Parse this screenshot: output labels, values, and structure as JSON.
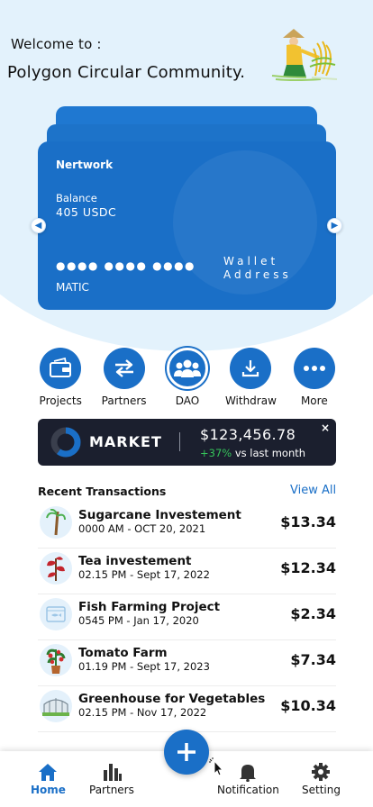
{
  "header": {
    "welcome": "Welcome  to :",
    "community": "Polygon Circular Community."
  },
  "card": {
    "network": "Nertwork",
    "balance_label": "Balance",
    "balance_value": "405 USDC",
    "masked_number": "●●●● ●●●● ●●●●",
    "wallet_line1": "Wallet",
    "wallet_line2": "Address",
    "currency": "MATIC"
  },
  "actions": [
    {
      "label": "Projects",
      "icon": "wallet-icon"
    },
    {
      "label": "Partners",
      "icon": "swap-arrows-icon"
    },
    {
      "label": "DAO",
      "icon": "group-icon"
    },
    {
      "label": "Withdraw",
      "icon": "download-icon"
    },
    {
      "label": "More",
      "icon": "more-dots-icon"
    }
  ],
  "market": {
    "title": "MARKET",
    "value": "$123,456.78",
    "change_pct": "+37%",
    "change_text": " vs last month",
    "ring_fraction": 0.6,
    "close": "×"
  },
  "recent": {
    "title": "Recent Transactions",
    "view_all": "View All",
    "items": [
      {
        "name": "Sugarcane Investement",
        "date": "0000 AM - OCT 20, 2021",
        "amount": "$13.34",
        "icon": "sugarcane-icon"
      },
      {
        "name": "Tea investement",
        "date": "02.15 PM - Sept 17, 2022",
        "amount": "$12.34",
        "icon": "tea-plant-icon"
      },
      {
        "name": "Fish Farming Project",
        "date": "0545 PM - Jan 17, 2020",
        "amount": "$2.34",
        "icon": "fish-tank-icon"
      },
      {
        "name": "Tomato Farm",
        "date": "01.19 PM - Sept 17, 2023",
        "amount": "$7.34",
        "icon": "tomato-plant-icon"
      },
      {
        "name": "Greenhouse for Vegetables",
        "date": "02.15 PM - Nov 17, 2022",
        "amount": "$10.34",
        "icon": "greenhouse-icon"
      }
    ]
  },
  "nav": {
    "home": "Home",
    "partners": "Partners",
    "notification": "Notification",
    "setting": "Setting"
  },
  "colors": {
    "primary": "#1a6fc7",
    "market_bg": "#1b1f2e",
    "positive": "#35c35a",
    "header_bg": "#e3f2fc"
  }
}
